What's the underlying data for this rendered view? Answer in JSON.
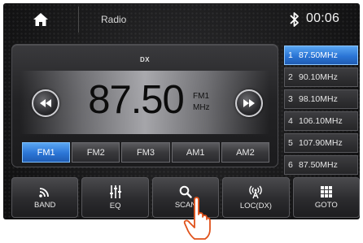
{
  "header": {
    "home_icon": "home-icon",
    "title": "Radio",
    "bluetooth_icon": "bluetooth-icon",
    "time": "00:06"
  },
  "tuner": {
    "mode": "DX",
    "frequency": "87.50",
    "band": "FM1",
    "unit": "MHz",
    "seek_prev_icon": "seek-backward-icon",
    "seek_next_icon": "seek-forward-icon"
  },
  "bands": [
    {
      "label": "FM1",
      "active": true
    },
    {
      "label": "FM2",
      "active": false
    },
    {
      "label": "FM3",
      "active": false
    },
    {
      "label": "AM1",
      "active": false
    },
    {
      "label": "AM2",
      "active": false
    }
  ],
  "presets": [
    {
      "num": "1",
      "freq": "87.50MHz",
      "active": true
    },
    {
      "num": "2",
      "freq": "90.10MHz",
      "active": false
    },
    {
      "num": "3",
      "freq": "98.10MHz",
      "active": false
    },
    {
      "num": "4",
      "freq": "106.10MHz",
      "active": false
    },
    {
      "num": "5",
      "freq": "107.90MHz",
      "active": false
    },
    {
      "num": "6",
      "freq": "87.50MHz",
      "active": false
    }
  ],
  "toolbar": [
    {
      "label": "BAND",
      "icon": "signal-icon"
    },
    {
      "label": "EQ",
      "icon": "equalizer-icon"
    },
    {
      "label": "SCAN",
      "icon": "search-icon"
    },
    {
      "label": "LOC(DX)",
      "icon": "antenna-icon"
    },
    {
      "label": "GOTO",
      "icon": "grid-icon"
    }
  ],
  "overlay": {
    "pointer_icon": "hand-pointer-icon"
  },
  "colors": {
    "accent_blue": "#2b75d6",
    "background": "#161617",
    "text": "#e8e8e8"
  }
}
